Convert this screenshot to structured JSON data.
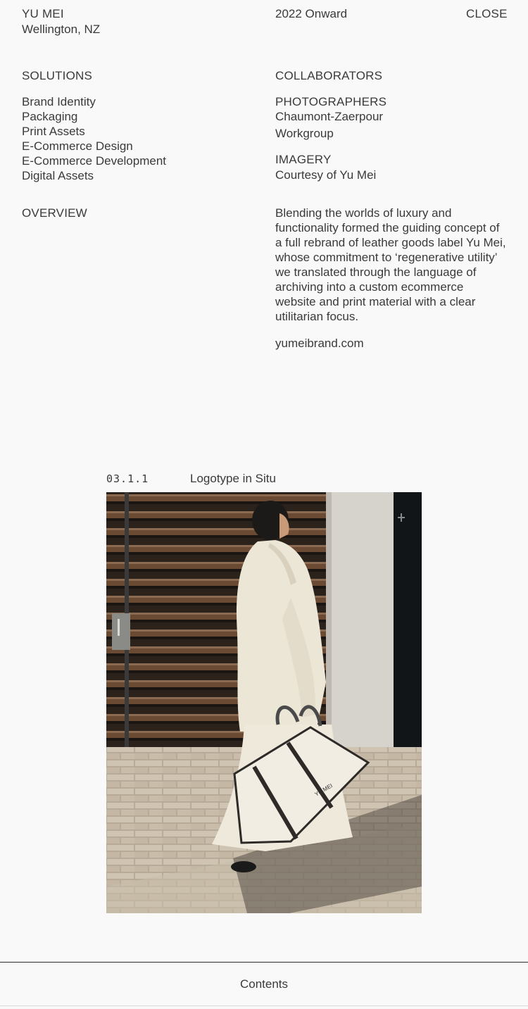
{
  "header": {
    "brand": "YU MEI",
    "location": "Wellington, NZ",
    "period": "2022 Onward",
    "close_label": "CLOSE"
  },
  "solutions": {
    "title": "SOLUTIONS",
    "items": [
      "Brand Identity",
      "Packaging",
      "Print Assets",
      "E-Commerce Design",
      "E-Commerce Development",
      "Digital Assets"
    ]
  },
  "collaborators": {
    "title": "COLLABORATORS",
    "photographers_title": "PHOTOGRAPHERS",
    "photographers": [
      "Chaumont-Zaerpour",
      "Workgroup"
    ],
    "imagery_title": "IMAGERY",
    "imagery": "Courtesy of Yu Mei"
  },
  "overview": {
    "title": "OVERVIEW",
    "text": "Blending the worlds of luxury and functionality formed the guiding concept of a full rebrand of leather goods label Yu Mei, whose commitment to ‘regenerative utility’ we translated through the language of archiving into a custom ecommerce website and print material with a clear utilitarian focus.",
    "link": "yumeibrand.com"
  },
  "figure": {
    "number": "03.1.1",
    "caption": "Logotype in Situ",
    "bag_logo": "YU MEI"
  },
  "footer": {
    "contents_label": "Contents"
  }
}
